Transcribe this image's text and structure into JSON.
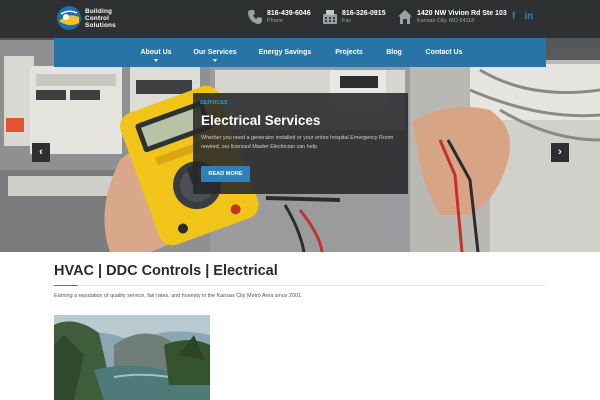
{
  "header": {
    "logo_lines": [
      "Building",
      "Control",
      "Solutions"
    ],
    "phone": {
      "number": "816-439-6046",
      "label": "Phone"
    },
    "fax": {
      "number": "816-326-0915",
      "label": "Fax"
    },
    "address": {
      "line1": "1420 NW Vivion Rd Ste 103",
      "line2": "Kansas City, MO 64118"
    },
    "social": [
      {
        "icon": "facebook-icon",
        "label": "f"
      },
      {
        "icon": "linkedin-icon",
        "label": "in"
      }
    ]
  },
  "nav": {
    "items": [
      {
        "label": "About Us",
        "has_dropdown": true
      },
      {
        "label": "Our Services",
        "has_dropdown": true
      },
      {
        "label": "Energy Savings",
        "has_dropdown": false
      },
      {
        "label": "Projects",
        "has_dropdown": false
      },
      {
        "label": "Blog",
        "has_dropdown": false
      },
      {
        "label": "Contact Us",
        "has_dropdown": false
      }
    ]
  },
  "slider": {
    "prev_icon": "chevron-left-icon",
    "next_icon": "chevron-right-icon",
    "prev_label": "‹",
    "next_label": "›",
    "caption": {
      "tag": "SERVICES",
      "title": "Electrical Services",
      "description": "Whether you need a generator installed or your entire hospital Emergency Room rewired, our licensed Master Electrician can help.",
      "button": "READ MORE"
    }
  },
  "content": {
    "heading": "HVAC | DDC Controls | Electrical",
    "intro": "Earning a reputation of quality service, fair rates, and honesty in the Kansas City Metro Area since 2001."
  },
  "colors": {
    "brand_blue": "#2874a6",
    "accent_blue": "#2f7fb8",
    "top_bar": "#2b2d2f"
  }
}
